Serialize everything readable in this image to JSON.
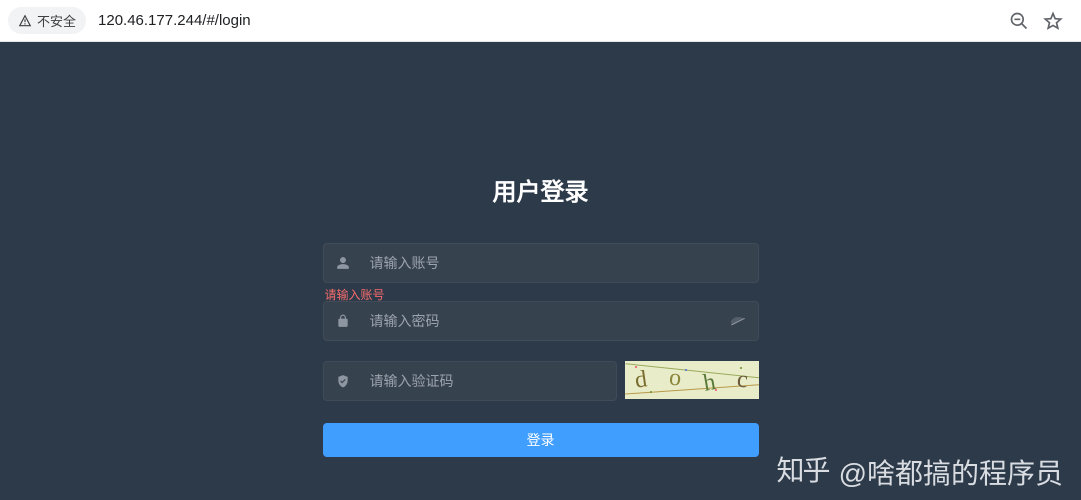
{
  "browser": {
    "security_label": "不安全",
    "url": "120.46.177.244/#/login"
  },
  "login": {
    "title": "用户登录",
    "username_placeholder": "请输入账号",
    "username_value": "",
    "username_error": "请输入账号",
    "password_placeholder": "请输入密码",
    "password_value": "",
    "captcha_placeholder": "请输入验证码",
    "captcha_value": "",
    "captcha_text": "dohc",
    "submit_label": "登录"
  },
  "watermark": {
    "logo_text": "知乎",
    "author": "@啥都搞的程序员"
  },
  "colors": {
    "page_bg": "#2d3a4a",
    "input_bg": "#37424f",
    "primary": "#409eff",
    "error": "#f56c6c"
  }
}
